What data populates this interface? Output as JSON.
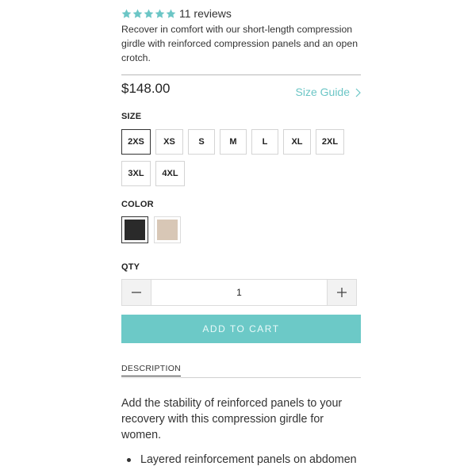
{
  "product": {
    "rating": {
      "stars": 5,
      "reviews_text": "11 reviews"
    },
    "short_description": "Recover in comfort with our short-length compression girdle with reinforced compression panels and an open crotch.",
    "price": "$148.00",
    "size_guide_label": "Size Guide"
  },
  "size": {
    "label": "SIZE",
    "options": [
      "2XS",
      "XS",
      "S",
      "M",
      "L",
      "XL",
      "2XL",
      "3XL",
      "4XL"
    ],
    "selected": "2XS"
  },
  "color": {
    "label": "COLOR",
    "swatches": [
      {
        "name": "black",
        "hex": "#2a2a2a",
        "selected": true
      },
      {
        "name": "nude",
        "hex": "#d8c7b6",
        "selected": false
      }
    ]
  },
  "qty": {
    "label": "QTY",
    "value": "1"
  },
  "cart": {
    "add_label": "ADD TO CART"
  },
  "tabs": {
    "description_label": "DESCRIPTION"
  },
  "description": {
    "body": "Add the stability of reinforced panels to your recovery with this compression girdle for women.",
    "bullet_1": "Layered reinforcement panels on abdomen"
  },
  "colors": {
    "accent": "#6cc9c7",
    "star": "#6cc6c6"
  }
}
